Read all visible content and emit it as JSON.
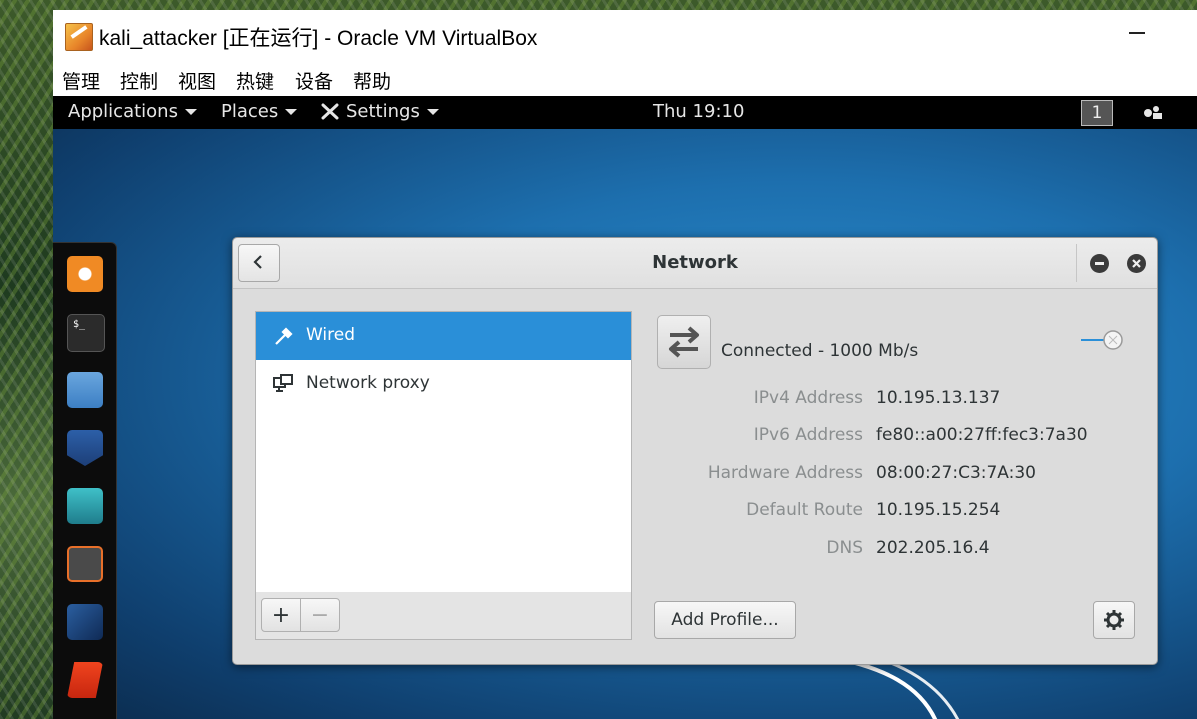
{
  "host": {
    "window_title": "kali_attacker [正在运行] - Oracle VM VirtualBox",
    "app_icon": "virtualbox-icon",
    "menubar": [
      "管理",
      "控制",
      "视图",
      "热键",
      "设备",
      "帮助"
    ]
  },
  "guest_topbar": {
    "applications_label": "Applications",
    "places_label": "Places",
    "settings_label": "Settings",
    "clock": "Thu 19:10",
    "workspace": "1"
  },
  "dock": {
    "items": [
      "firefox-icon",
      "terminal-icon",
      "files-icon",
      "metasploit-icon",
      "armitage-icon",
      "burpsuite-icon",
      "maltego-icon",
      "faraday-icon"
    ]
  },
  "network_dialog": {
    "title": "Network",
    "connections": [
      {
        "label": "Wired",
        "icon": "wired-icon",
        "selected": true
      },
      {
        "label": "Network proxy",
        "icon": "proxy-icon",
        "selected": false
      }
    ],
    "add_label": "+",
    "remove_label": "−",
    "status": "Connected - 1000 Mb/s",
    "switch_on": false,
    "details": [
      {
        "label": "IPv4 Address",
        "value": "10.195.13.137"
      },
      {
        "label": "IPv6 Address",
        "value": "fe80::a00:27ff:fec3:7a30"
      },
      {
        "label": "Hardware Address",
        "value": "08:00:27:C3:7A:30"
      },
      {
        "label": "Default Route",
        "value": "10.195.15.254"
      },
      {
        "label": "DNS",
        "value": "202.205.16.4"
      }
    ],
    "add_profile_label": "Add Profile...",
    "selection_color": "#2a8fd8"
  }
}
